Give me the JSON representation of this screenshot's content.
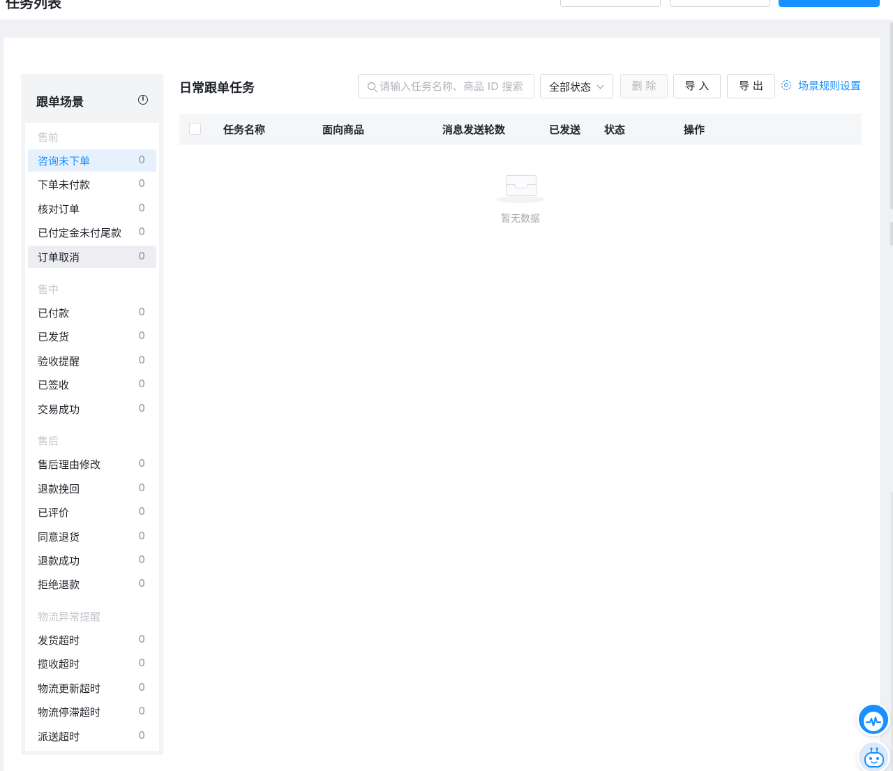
{
  "topbar": {
    "title": "任务列表"
  },
  "sidebar": {
    "title": "跟单场景",
    "info_icon": "i",
    "groups": [
      {
        "label": "售前",
        "items": [
          {
            "label": "咨询未下单",
            "count": "0"
          },
          {
            "label": "下单未付款",
            "count": "0"
          },
          {
            "label": "核对订单",
            "count": "0"
          },
          {
            "label": "已付定金未付尾款",
            "count": "0"
          },
          {
            "label": "订单取消",
            "count": "0"
          }
        ]
      },
      {
        "label": "售中",
        "items": [
          {
            "label": "已付款",
            "count": "0"
          },
          {
            "label": "已发货",
            "count": "0"
          },
          {
            "label": "验收提醒",
            "count": "0"
          },
          {
            "label": "已签收",
            "count": "0"
          },
          {
            "label": "交易成功",
            "count": "0"
          }
        ]
      },
      {
        "label": "售后",
        "items": [
          {
            "label": "售后理由修改",
            "count": "0"
          },
          {
            "label": "退款挽回",
            "count": "0"
          },
          {
            "label": "已评价",
            "count": "0"
          },
          {
            "label": "同意退货",
            "count": "0"
          },
          {
            "label": "退款成功",
            "count": "0"
          },
          {
            "label": "拒绝退款",
            "count": "0"
          }
        ]
      },
      {
        "label": "物流异常提醒",
        "items": [
          {
            "label": "发货超时",
            "count": "0"
          },
          {
            "label": "揽收超时",
            "count": "0"
          },
          {
            "label": "物流更新超时",
            "count": "0"
          },
          {
            "label": "物流停滞超时",
            "count": "0"
          },
          {
            "label": "派送超时",
            "count": "0"
          }
        ]
      }
    ]
  },
  "main": {
    "title": "日常跟单任务",
    "search": {
      "placeholder": "请输入任务名称、商品 ID 搜索",
      "value": ""
    },
    "status_select": {
      "value": "全部状态"
    },
    "delete_label": "删 除",
    "import_label": "导 入",
    "export_label": "导 出",
    "rule_settings_label": "场景规则设置",
    "table": {
      "columns": [
        "任务名称",
        "面向商品",
        "消息发送轮数",
        "已发送",
        "状态",
        "操作"
      ],
      "rows": []
    },
    "empty_text": "暂无数据"
  },
  "colors": {
    "accent": "#1890ff",
    "active_bg": "#e6f1fd",
    "group_label": "#c4c7cc"
  },
  "icons": {
    "search": "search-icon",
    "select": "chevron-down-icon",
    "rule": "gear-icon",
    "empty": "empty-inbox-icon",
    "float1": "pulse-icon",
    "float2": "robot-icon"
  }
}
